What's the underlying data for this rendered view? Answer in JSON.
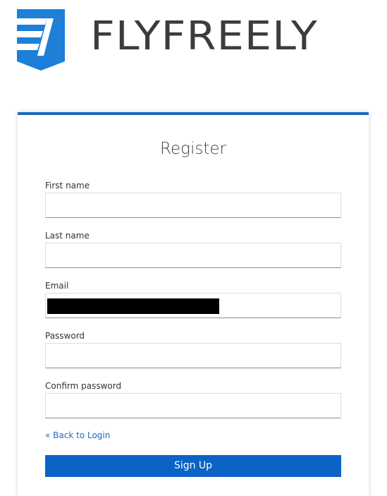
{
  "brand": {
    "name": "FLYFREELY",
    "logo_icon": "flyfreely-shield-logo",
    "logo_color": "#1d7fd8",
    "wordmark_color": "#3a3d3f"
  },
  "form": {
    "title": "Register",
    "accent_color": "#1b6ac4",
    "fields": {
      "first_name": {
        "label": "First name",
        "value": ""
      },
      "last_name": {
        "label": "Last name",
        "value": ""
      },
      "email": {
        "label": "Email",
        "value": "",
        "redacted": true
      },
      "password": {
        "label": "Password",
        "value": ""
      },
      "confirm_password": {
        "label": "Confirm password",
        "value": ""
      }
    },
    "back_link": "« Back to Login",
    "submit_label": "Sign Up",
    "submit_color": "#0b63c5"
  }
}
